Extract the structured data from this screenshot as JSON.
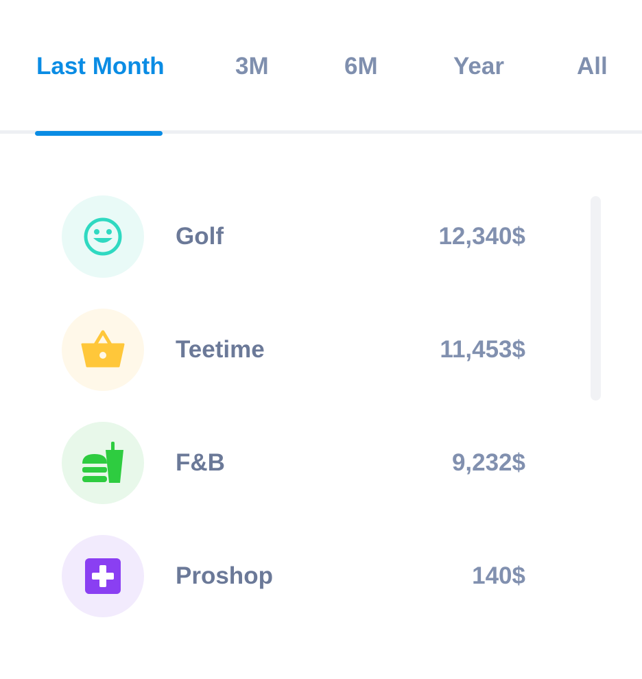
{
  "tabs": [
    {
      "label": "Last Month",
      "active": true
    },
    {
      "label": "3M",
      "active": false
    },
    {
      "label": "6M",
      "active": false
    },
    {
      "label": "Year",
      "active": false
    },
    {
      "label": "All",
      "active": false
    }
  ],
  "items": [
    {
      "label": "Golf",
      "value": "12,340$",
      "icon": "smiley-face-icon",
      "color": "#2fd9c1",
      "bg": "#e9faf7"
    },
    {
      "label": "Teetime",
      "value": "11,453$",
      "icon": "shopping-basket-icon",
      "color": "#ffc73a",
      "bg": "#fff8e9"
    },
    {
      "label": "F&B",
      "value": "9,232$",
      "icon": "burger-drink-icon",
      "color": "#2ecc40",
      "bg": "#e8f8ea"
    },
    {
      "label": "Proshop",
      "value": "140$",
      "icon": "medical-cross-icon",
      "color": "#8a3ff2",
      "bg": "#f2ebfd"
    }
  ],
  "colors": {
    "accent": "#0a8ce4",
    "tab_inactive": "#7f8fae",
    "label_text": "#6b7998",
    "value_text": "#8190af"
  }
}
